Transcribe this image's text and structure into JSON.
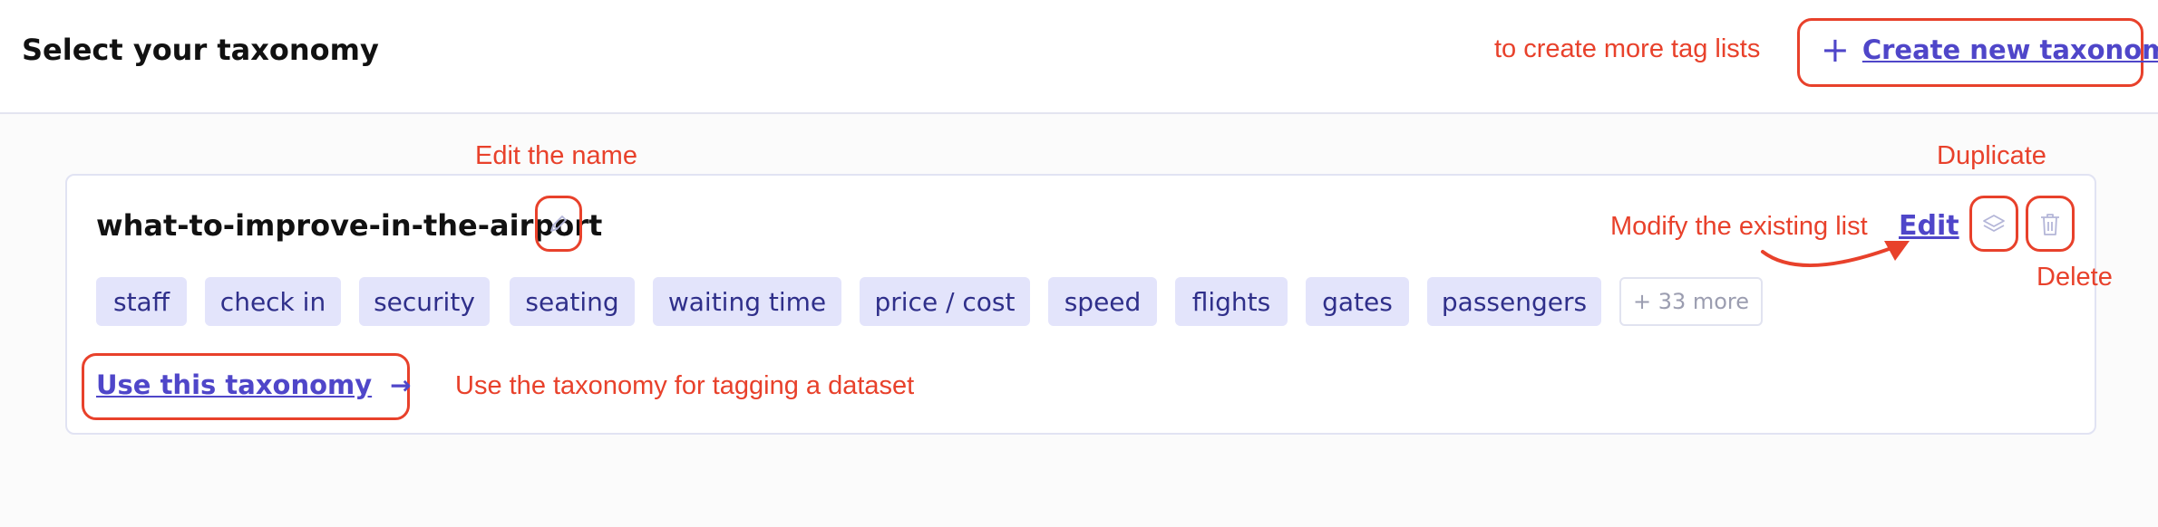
{
  "header": {
    "title": "Select your taxonomy",
    "create_label": "Create new taxonomy",
    "create_icon": "plus-icon"
  },
  "taxonomy": {
    "name": "what-to-improve-in-the-airport",
    "rename_icon": "pencil-icon",
    "edit_label": "Edit",
    "duplicate_icon": "layers-icon",
    "delete_icon": "trash-icon",
    "tags": [
      "staff",
      "check in",
      "security",
      "seating",
      "waiting time",
      "price / cost",
      "speed",
      "flights",
      "gates",
      "passengers"
    ],
    "more_label": "+ 33 more",
    "use_label": "Use this taxonomy",
    "use_icon": "arrow-right-icon"
  },
  "annotations": {
    "create_more": "to create more tag lists",
    "edit_name": "Edit the name",
    "duplicate": "Duplicate",
    "modify": "Modify the existing list",
    "delete": "Delete",
    "use": "Use the taxonomy for tagging a dataset"
  },
  "colors": {
    "accent": "#4f46c9",
    "annotation": "#e8412b",
    "tag_bg": "#e3e4fb",
    "tag_text": "#2f2f8a"
  }
}
